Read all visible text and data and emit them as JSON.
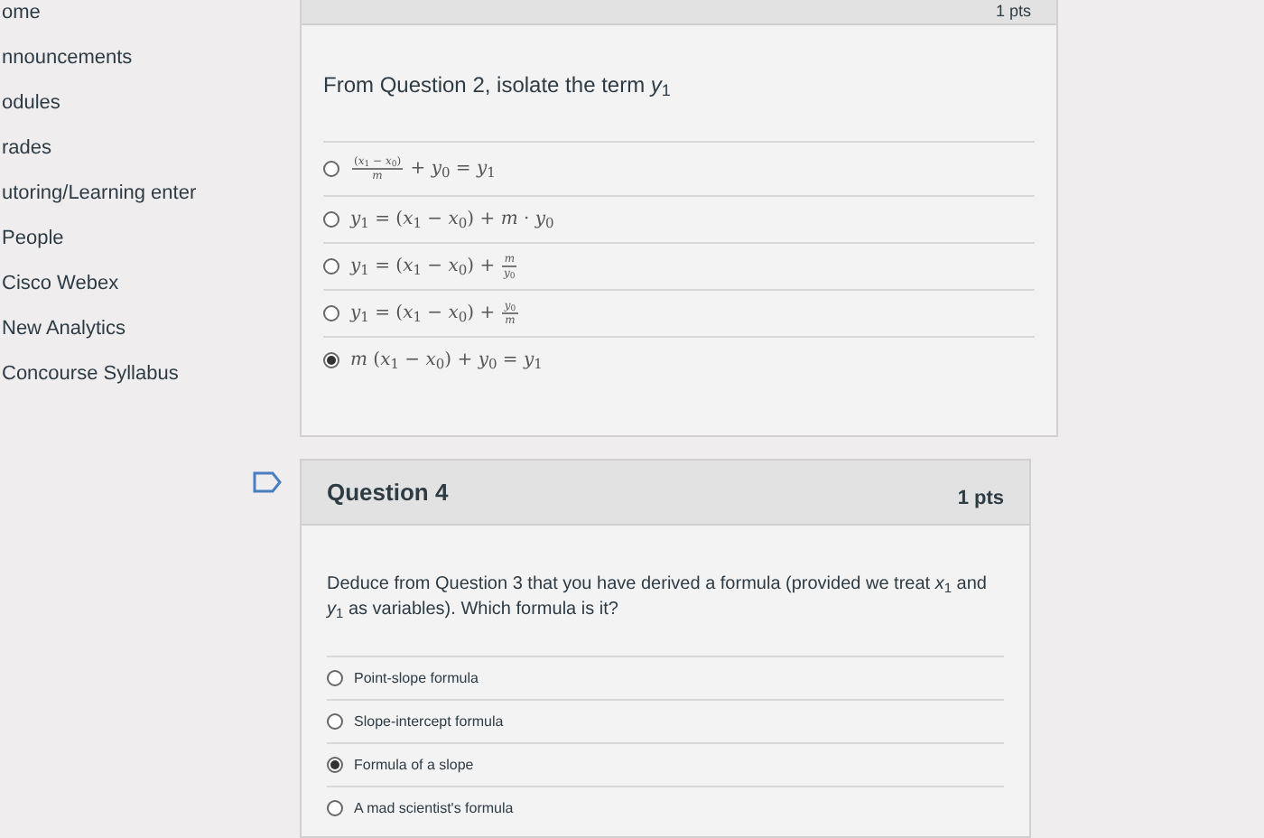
{
  "sidebar": {
    "items": [
      {
        "label": "ome"
      },
      {
        "label": "nnouncements"
      },
      {
        "label": "odules"
      },
      {
        "label": "rades"
      },
      {
        "label": "utoring/Learning enter"
      },
      {
        "label": "People"
      },
      {
        "label": "Cisco Webex"
      },
      {
        "label": "New Analytics"
      },
      {
        "label": "Concourse Syllabus"
      }
    ]
  },
  "previous_question": {
    "points": "1 pts",
    "prompt": "From Question 2, isolate the term *y*$_{1}$",
    "options": [
      {
        "selected": false,
        "segments": [
          {
            "kind": "frac",
            "num": "(*x*$_{1}$ − *x*$_{0}$)",
            "den": "*m*"
          },
          {
            "kind": "text",
            "text": " + *y*$_{0}$ = *y*$_{1}$"
          }
        ]
      },
      {
        "selected": false,
        "segments": [
          {
            "kind": "text",
            "text": "*y*$_{1}$ = (*x*$_{1}$ − *x*$_{0}$) + *m* · *y*$_{0}$"
          }
        ]
      },
      {
        "selected": false,
        "segments": [
          {
            "kind": "text",
            "text": "*y*$_{1}$ = (*x*$_{1}$ − *x*$_{0}$) + "
          },
          {
            "kind": "frac",
            "num": "*m*",
            "den": "*y*$_{0}$"
          }
        ]
      },
      {
        "selected": false,
        "segments": [
          {
            "kind": "text",
            "text": "*y*$_{1}$ = (*x*$_{1}$ − *x*$_{0}$) + "
          },
          {
            "kind": "frac",
            "num": "*y*$_{0}$",
            "den": "*m*"
          }
        ]
      },
      {
        "selected": true,
        "segments": [
          {
            "kind": "text",
            "text": "*m* (*x*$_{1}$ − *x*$_{0}$) + *y*$_{0}$ = *y*$_{1}$"
          }
        ]
      }
    ]
  },
  "question": {
    "title": "Question 4",
    "points": "1 pts",
    "prompt": "Deduce from Question 3 that you have derived a formula (provided we treat *x*$_{1}$ and *y*$_{1}$ as variables). Which formula is it?",
    "options": [
      {
        "label": "Point-slope formula",
        "selected": false
      },
      {
        "label": "Slope-intercept formula",
        "selected": false
      },
      {
        "label": "Formula of a slope",
        "selected": true
      },
      {
        "label": "A mad scientist's formula",
        "selected": false
      }
    ]
  }
}
